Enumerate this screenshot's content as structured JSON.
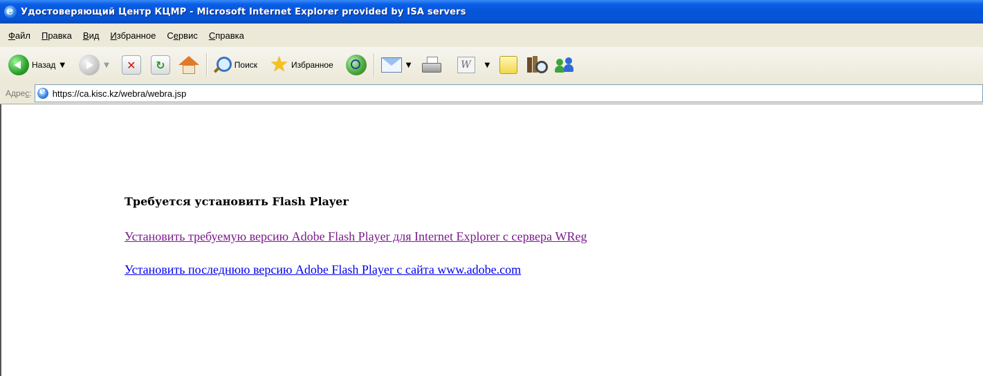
{
  "window": {
    "title": "Удостоверяющий Центр КЦМР - Microsoft Internet Explorer provided by ISA servers"
  },
  "menu": {
    "items": [
      {
        "label": "Файл",
        "accel": "Ф",
        "rest": "айл"
      },
      {
        "label": "Правка",
        "accel": "П",
        "rest": "равка"
      },
      {
        "label": "Вид",
        "accel": "В",
        "rest": "ид"
      },
      {
        "label": "Избранное",
        "accel": "И",
        "rest": "збранное"
      },
      {
        "label": "Сервис",
        "accel": "е",
        "pre": "С",
        "rest": "рвис"
      },
      {
        "label": "Справка",
        "accel": "С",
        "rest": "правка"
      }
    ]
  },
  "toolbar": {
    "back_label": "Назад",
    "search_label": "Поиск",
    "favorites_label": "Избранное",
    "icons": [
      "back-icon",
      "forward-icon",
      "stop-icon",
      "refresh-icon",
      "home-icon",
      "search-icon",
      "favorites-star-icon",
      "media-icon",
      "mail-icon",
      "print-icon",
      "edit-word-icon",
      "discuss-note-icon",
      "research-icon",
      "messenger-icon"
    ]
  },
  "address": {
    "label_accel": "с",
    "label_pre": "Адре",
    "label_post": ":",
    "url": "https://ca.kisc.kz/webra/webra.jsp"
  },
  "content": {
    "heading": "Требуется установить Flash Player",
    "link_install_required": "Установить требуемую версию Adobe Flash Player для Internet Explorer с сервера WReg",
    "link_install_latest": "Установить последнюю версию Adobe Flash Player с сайта www.adobe.com"
  },
  "colors": {
    "titlebar": "#0654d8",
    "chrome": "#ece9d8",
    "visited_link": "#7b1a8c",
    "link": "#0000ee"
  }
}
